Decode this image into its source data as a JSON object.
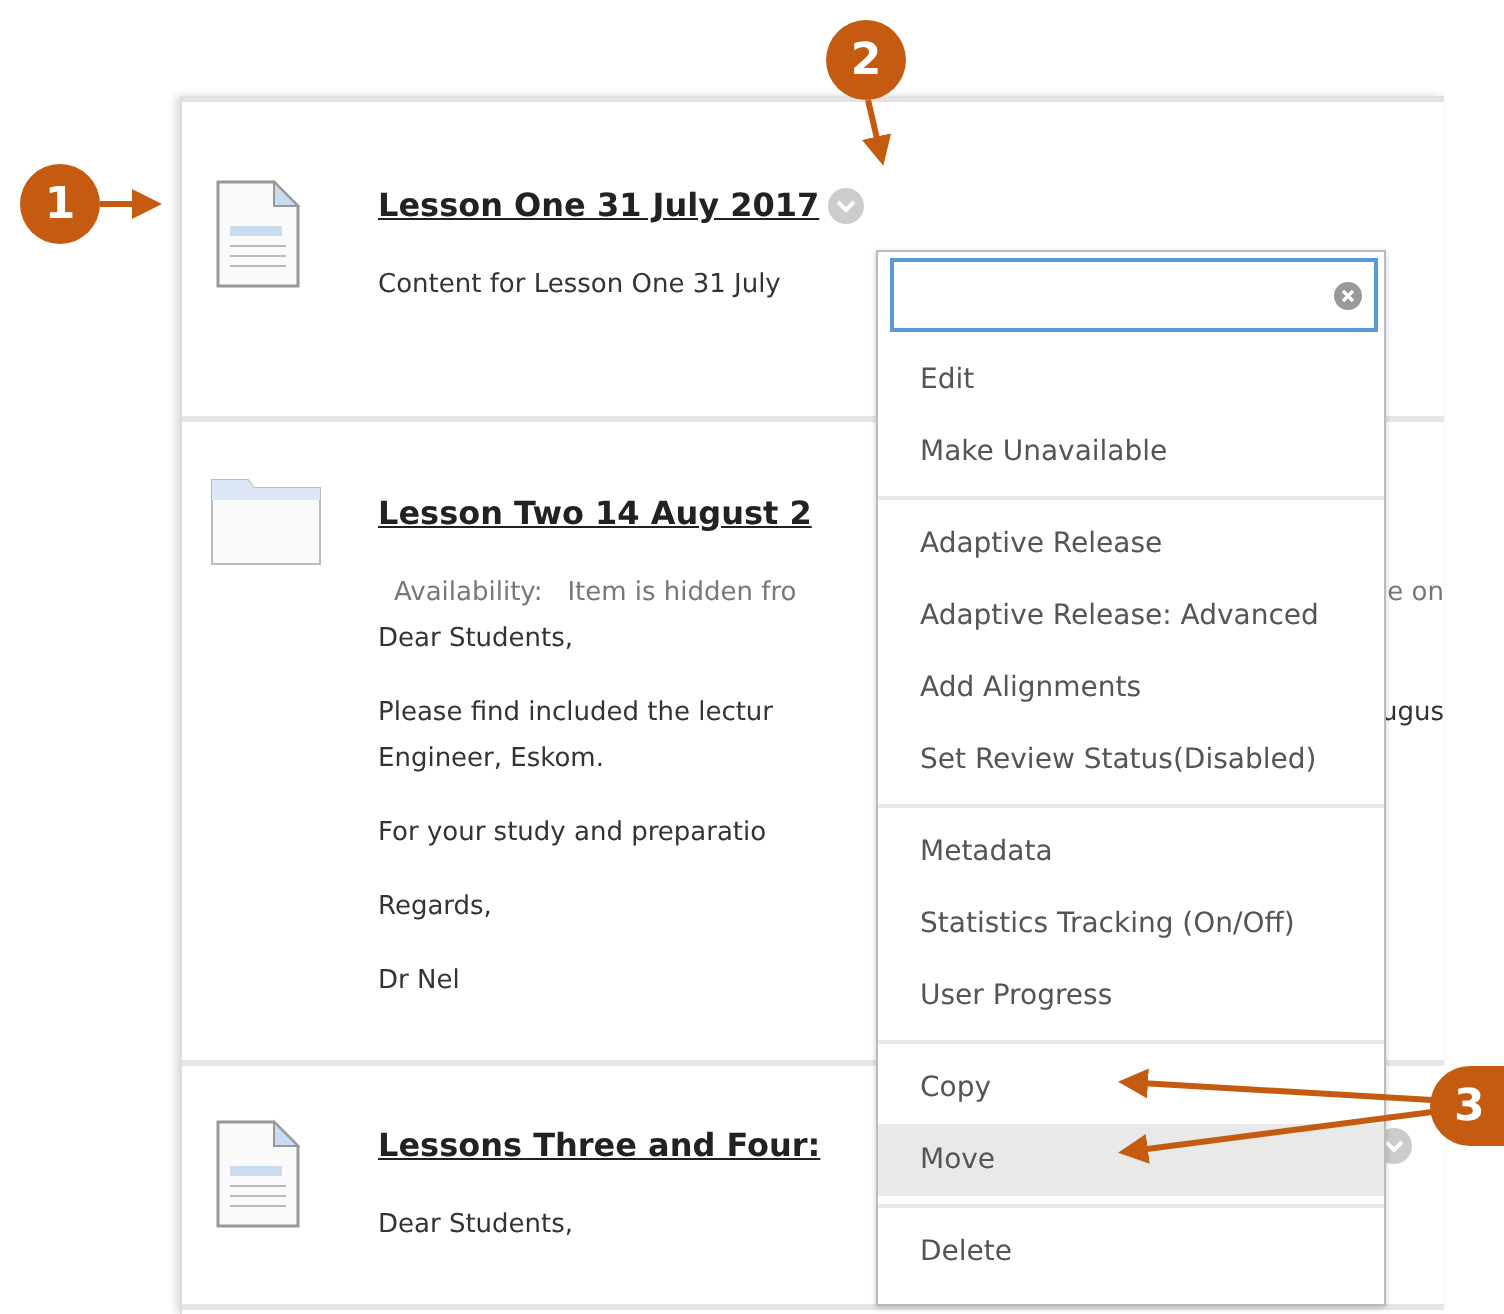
{
  "items": [
    {
      "kind": "document",
      "title": "Lesson One 31 July 2017",
      "options_button": true,
      "paragraphs": [
        {
          "lines": [
            {
              "text": "Content for Lesson One 31 July"
            }
          ]
        }
      ]
    },
    {
      "kind": "folder",
      "title": "Lesson Two  14 August 2",
      "paragraphs": [
        {
          "kind": "availability",
          "label": "Availability:",
          "lines": [
            {
              "text": "Item is hidden fro",
              "tail": "e on"
            }
          ]
        },
        {
          "lines": [
            {
              "text": "Dear Students,"
            }
          ]
        },
        {
          "lines": [
            {
              "text": "Please find included the lectur",
              "tail": "ugus"
            },
            {
              "text": "Engineer, Eskom."
            }
          ]
        },
        {
          "lines": [
            {
              "text": "For your study and preparatio"
            }
          ]
        },
        {
          "lines": [
            {
              "text": "Regards,"
            }
          ]
        },
        {
          "lines": [
            {
              "text": "Dr Nel"
            }
          ]
        }
      ]
    },
    {
      "kind": "document",
      "title": "Lessons Three and Four:",
      "options_button": true,
      "options_at_end": true,
      "paragraphs": [
        {
          "lines": [
            {
              "text": "Dear Students,"
            }
          ]
        }
      ]
    }
  ],
  "menu": {
    "groups": [
      {
        "items": [
          {
            "label": "Edit",
            "selected": false
          },
          {
            "label": "Make Unavailable",
            "selected": false
          }
        ]
      },
      {
        "items": [
          {
            "label": "Adaptive Release",
            "selected": false
          },
          {
            "label": "Adaptive Release: Advanced",
            "selected": false
          },
          {
            "label": "Add Alignments",
            "selected": false
          },
          {
            "label": "Set Review Status(Disabled)",
            "selected": false
          }
        ]
      },
      {
        "items": [
          {
            "label": "Metadata",
            "selected": false
          },
          {
            "label": "Statistics Tracking (On/Off)",
            "selected": false
          },
          {
            "label": "User Progress",
            "selected": false
          }
        ]
      },
      {
        "items": [
          {
            "label": "Copy",
            "selected": false
          },
          {
            "label": "Move",
            "selected": true
          }
        ]
      },
      {
        "items": [
          {
            "label": "Delete",
            "selected": false
          }
        ]
      }
    ]
  },
  "callouts": [
    {
      "number": "1"
    },
    {
      "number": "2"
    },
    {
      "number": "3"
    }
  ]
}
